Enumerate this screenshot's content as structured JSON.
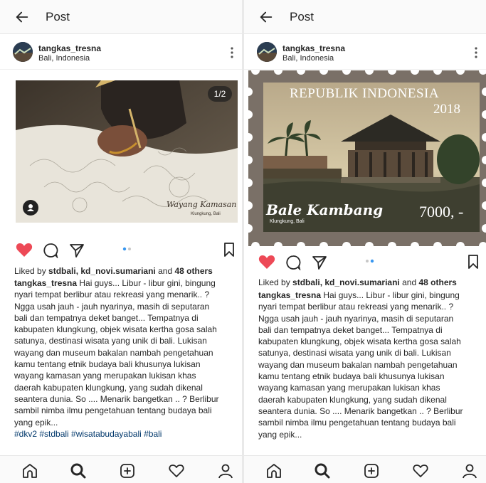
{
  "header": {
    "title": "Post"
  },
  "post": {
    "username": "tangkas_tresna",
    "location": "Bali, Indonesia",
    "carousel_counter": "1/2",
    "liked_by_prefix": "Liked by",
    "liked_by_users": "stdbali, kd_novi.sumariani",
    "liked_by_and": "and",
    "liked_by_others": "48 others",
    "caption_user": "tangkas_tresna",
    "caption_lines": [
      "Hai guys... Libur - libur gini, bingung",
      "nyari tempat berlibur atau rekreasi yang menarik.. ?",
      "Ngga usah jauh - jauh nyarinya, masih di seputaran",
      "bali dan tempatnya deket banget... Tempatnya di",
      "kabupaten klungkung, objek wisata kertha gosa salah",
      "satunya, destinasi wisata yang unik di bali. Lukisan",
      "wayang dan museum  bakalan nambah pengetahuan",
      "kamu tentang etnik budaya bali khusunya lukisan",
      "wayang kamasan yang merupakan lukisan khas",
      "daerah kabupaten klungkung, yang sudah dikenal",
      "seantera dunia. So .... Menarik bangetkan .. ? Berlibur",
      "sambil nimba ilmu pengetahuan tentang budaya bali",
      "yang epik..."
    ],
    "hashtags": "#dkv2 #stdbali #wisatabudayabali #bali"
  },
  "photo_left": {
    "watermark_title": "Wayang Kamasan",
    "watermark_sub": "Klungkung, Bali"
  },
  "photo_right": {
    "stamp_country": "REPUBLIK INDONESIA",
    "stamp_year": "2018",
    "stamp_title": "Bale Kambang",
    "stamp_sub": "Klungkung, Bali",
    "stamp_value": "7000, -"
  },
  "colors": {
    "heart": "#ed4956",
    "stamp_border": "#7a7067",
    "hashtag": "#00376b"
  },
  "icons": {
    "nav": [
      "home-icon",
      "search-icon",
      "add-post-icon",
      "activity-heart-icon",
      "profile-icon"
    ],
    "actions": [
      "like-heart-icon",
      "comment-icon",
      "share-icon",
      "save-bookmark-icon"
    ]
  }
}
